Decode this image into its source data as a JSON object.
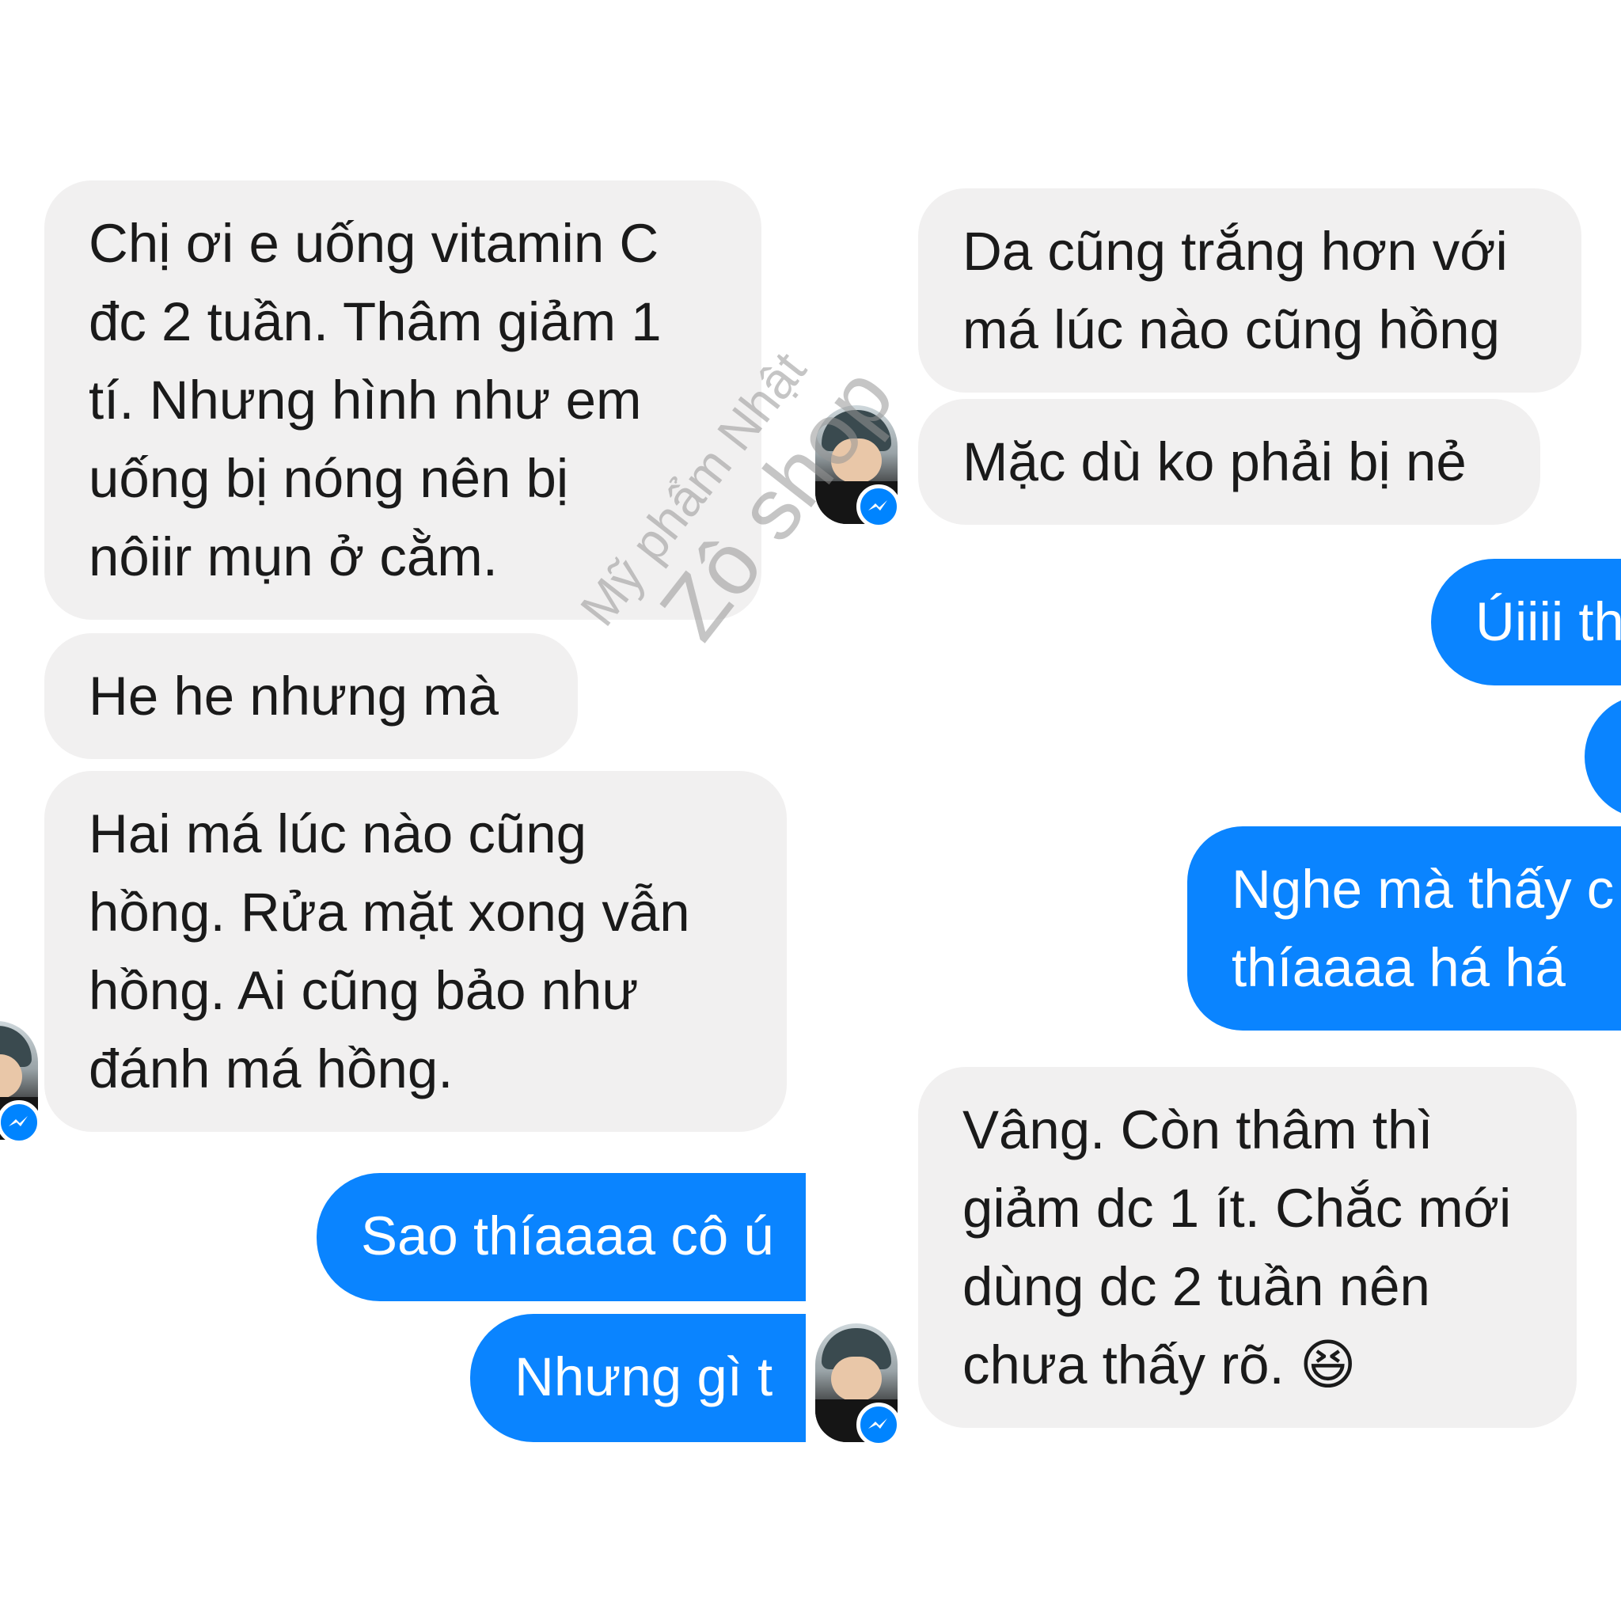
{
  "colors": {
    "incoming_bubble": "#f1f0f0",
    "outgoing_bubble": "#0a84ff",
    "messenger_badge": "#0084ff"
  },
  "left_panel": {
    "incoming": [
      "Chị ơi e uống vitamin C\nđc 2 tuần. Thâm giảm 1\ntí. Nhưng hình như em\nuống bị nóng nên bị\nnôiir mụn ở cằm.",
      "He he nhưng mà",
      "Hai má lúc nào cũng\nhồng. Rửa mặt xong vẫn\nhồng. Ai cũng bảo như\nđánh má hồng."
    ],
    "outgoing": [
      "Sao thíaaaa cô ú",
      "Nhưng gì t"
    ]
  },
  "right_panel": {
    "incoming_top": [
      "Da cũng trắng hơn với\nmá lúc nào cũng hồng",
      "Mặc dù ko phải bị nẻ"
    ],
    "outgoing": [
      "Úiiii th",
      "",
      "Nghe mà thấy c\nthíaaaa há há"
    ],
    "incoming_bottom": "Vâng. Còn thâm thì\ngiảm dc 1 ít. Chắc mới\ndùng dc 2 tuần nên\nchưa thấy rõ. 😆"
  },
  "avatar_icon": "messenger-badge-icon",
  "watermark": {
    "line1": "Mỹ phẩm Nhật",
    "line2": "Zô shop"
  }
}
